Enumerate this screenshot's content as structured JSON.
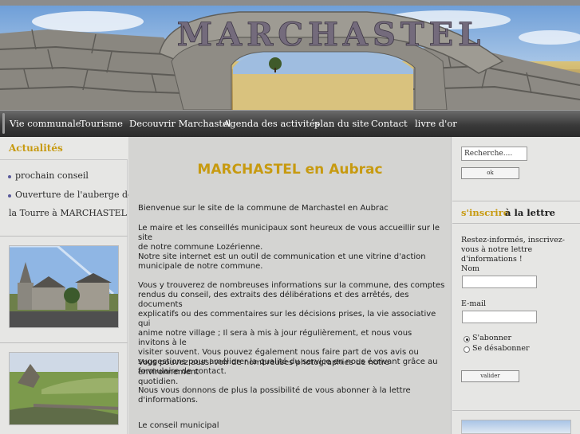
{
  "header": {
    "banner_text": "MARCHASTEL"
  },
  "nav": {
    "items": [
      {
        "label": "Vie communale"
      },
      {
        "label": "Tourisme"
      },
      {
        "label": "Decouvrir Marchastel"
      },
      {
        "label": "Agenda des activités"
      },
      {
        "label": "plan du site"
      },
      {
        "label": "Contact"
      },
      {
        "label": "livre d'or"
      }
    ]
  },
  "left": {
    "heading": "Actualités",
    "news": [
      {
        "line1": "prochain conseil"
      },
      {
        "line1": "Ouverture de l'auberge de",
        "line2": "la Tourre à MARCHASTEL"
      }
    ]
  },
  "main": {
    "title": "MARCHASTEL en Aubrac",
    "paragraphs": [
      [
        "Bienvenue sur le site de la commune de Marchastel en Aubrac"
      ],
      [
        "Le maire et les conseillés municipaux sont  heureux de vous accueillir sur le site",
        "de notre commune Lozérienne."
      ],
      [
        "Notre site internet est un outil de communication et une vitrine d'action",
        "municipale de notre commune."
      ],
      [
        "Vous y trouverez de nombreuses informations sur la commune, des comptes",
        "rendus du conseil, des extraits des délibérations et des arrêtés, des documents",
        "explicatifs ou des commentaires sur les décisions prises, la vie associative qui",
        "anime notre village ;  Il sera à mis à jour régulièrement, et nous vous invitons à le",
        "visiter souvent. Vous pouvez également nous faire part de vos avis ou",
        "suggestions pour améliorer la qualité du service en nous écrivant grâce au",
        "formulaire de contact."
      ],
      [
        "Vous pouvez aussi voir de nombreuses photographies de notre environnement",
        "quotidien."
      ],
      [
        "Nous vous donnons de plus la possibilité de vous abonner à la lettre",
        "d'informations."
      ],
      [
        "Le conseil municipal"
      ]
    ]
  },
  "right": {
    "search_value": "Recherche....",
    "ok_label": "ok",
    "newsletter_heading_1": "s'inscrire",
    "newsletter_heading_2": "à la lettre",
    "intro": "Restez-informés, inscrivez-vous à notre lettre d'informations !",
    "nom_label": "Nom",
    "email_label": "E-mail",
    "subscribe_label": "S'abonner",
    "unsubscribe_label": "Se désabonner",
    "submit_label": "valider"
  }
}
